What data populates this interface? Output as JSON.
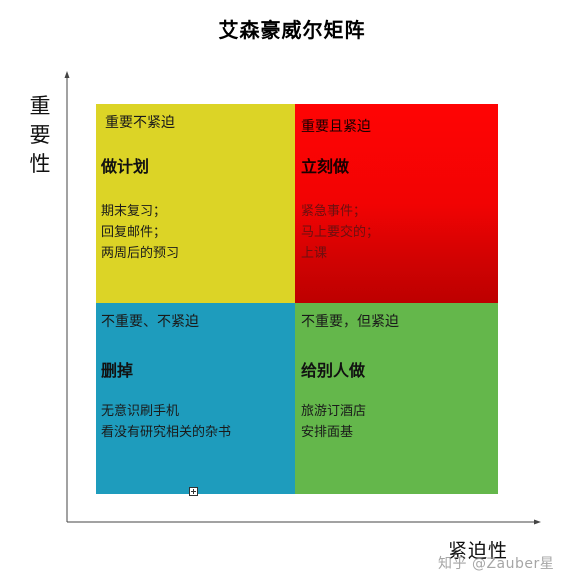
{
  "title": "艾森豪威尔矩阵",
  "y_axis_label": [
    "重",
    "要",
    "性"
  ],
  "x_axis_label": "紧迫性",
  "watermark": "知乎 @Zauber星",
  "colors": {
    "important_not_urgent": "#dcd426",
    "important_urgent": "#ee0202",
    "not_important_not_urgent": "#1e9cbd",
    "not_important_urgent": "#64b74b"
  },
  "quadrants": {
    "top_left": {
      "category": "重要不紧迫",
      "action": "做计划",
      "items": [
        "期末复习；",
        "回复邮件；",
        "两周后的预习"
      ]
    },
    "top_right": {
      "category": "重要且紧迫",
      "action": "立刻做",
      "items": [
        "紧急事件；",
        "马上要交的；",
        "上课"
      ]
    },
    "bottom_left": {
      "category": "不重要、不紧迫",
      "action": "删掉",
      "items": [
        "无意识刷手机",
        "看没有研究相关的杂书"
      ]
    },
    "bottom_right": {
      "category": "不重要，但紧迫",
      "action": "给别人做",
      "items": [
        "旅游订酒店",
        "安排面基"
      ]
    }
  }
}
